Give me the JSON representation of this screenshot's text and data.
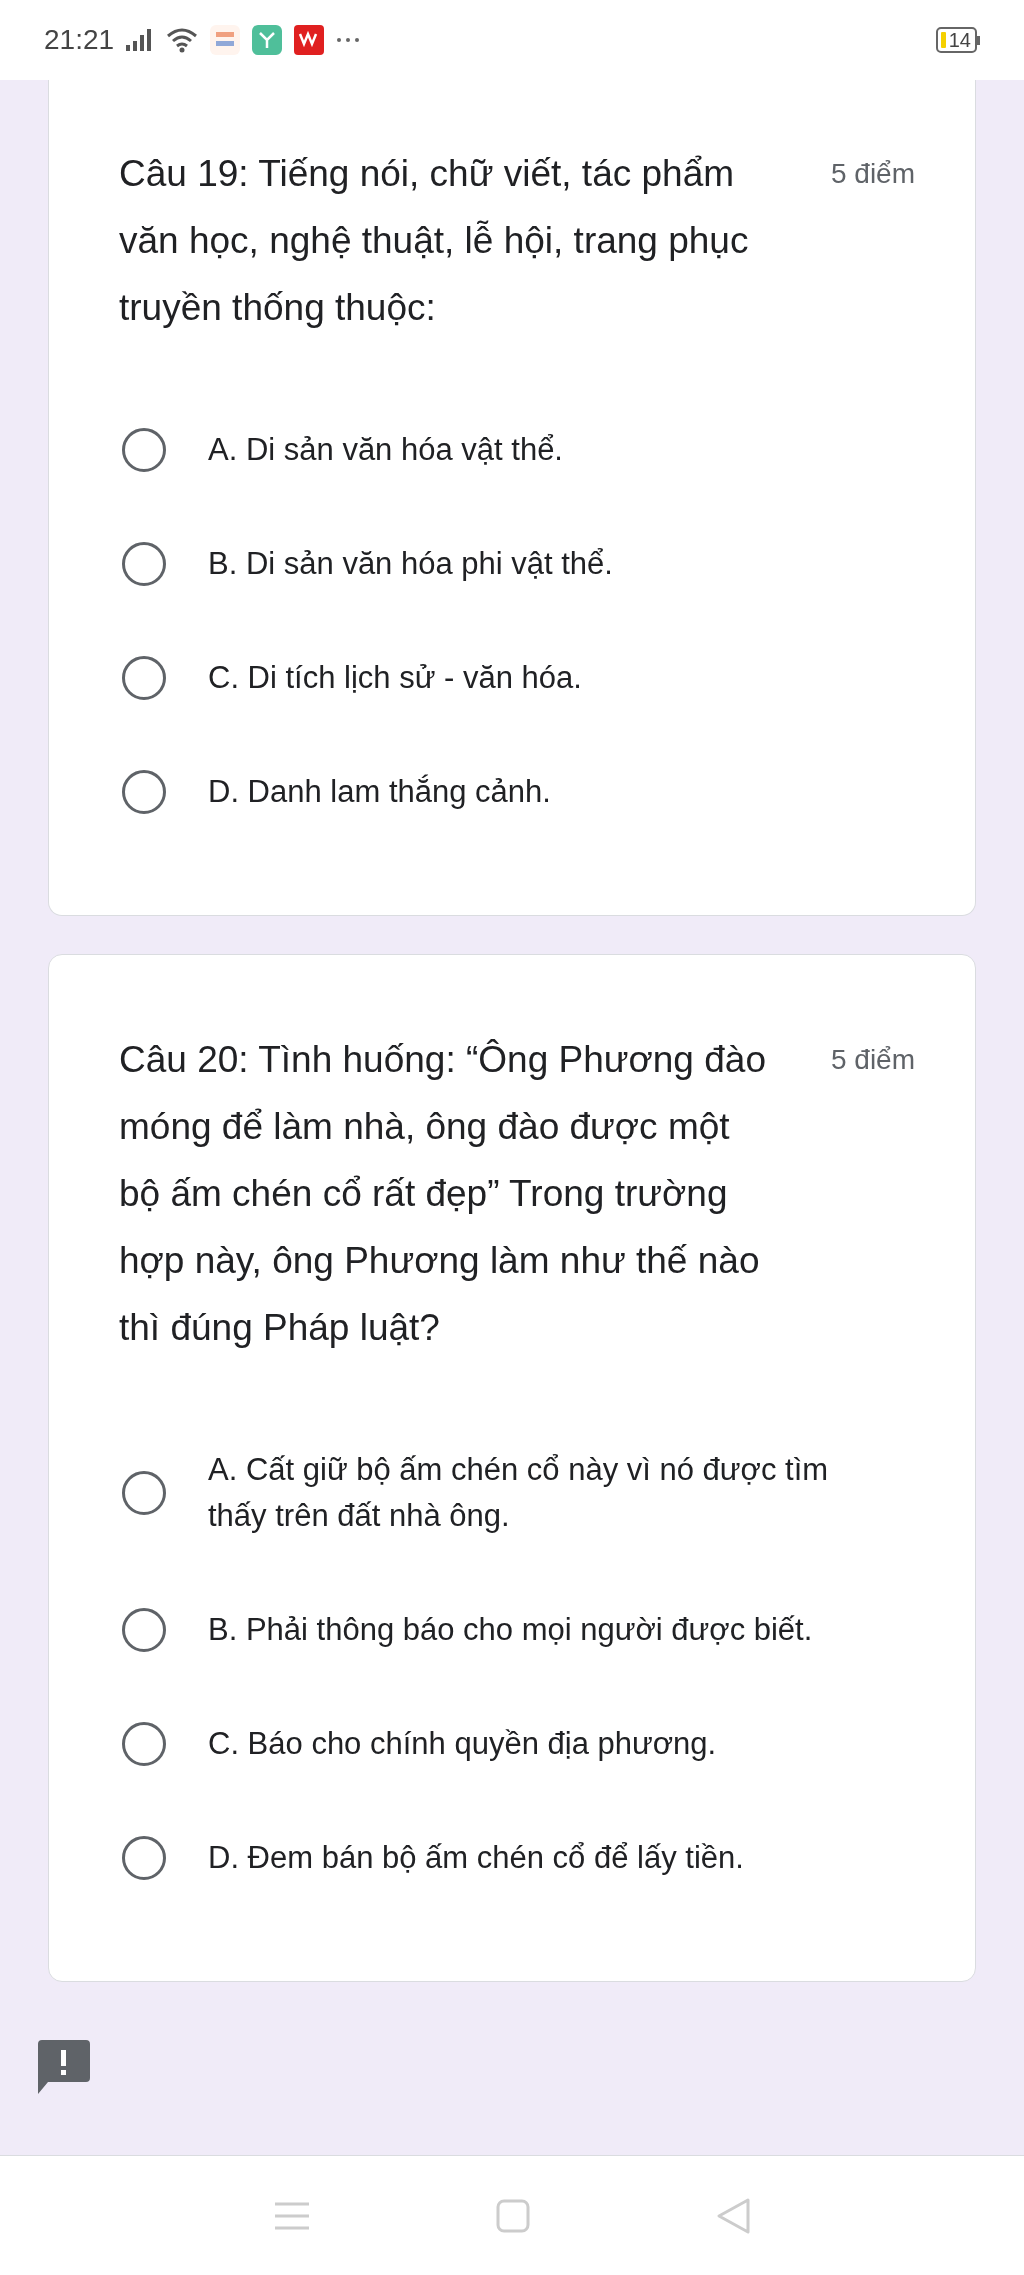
{
  "status_bar": {
    "time": "21:21",
    "battery": "14"
  },
  "questions": [
    {
      "title": "Câu 19: Tiếng nói, chữ viết, tác phẩm văn học, nghệ thuật, lễ hội, trang phục truyền thống thuộc:",
      "points": "5 điểm",
      "cut_top": true,
      "options": [
        {
          "label": "A. Di sản văn hóa vật thể.",
          "selected": false
        },
        {
          "label": "B. Di sản văn hóa phi vật thể.",
          "selected": false
        },
        {
          "label": "C. Di tích lịch sử - văn hóa.",
          "selected": false
        },
        {
          "label": "D. Danh lam thắng cảnh.",
          "selected": false
        }
      ]
    },
    {
      "title": "Câu 20: Tình huống: “Ông Phương đào móng để làm nhà, ông đào được một bộ ấm chén cổ rất đẹp” Trong trường hợp này, ông Phương làm như thế nào thì đúng Pháp luật?",
      "points": "5 điểm",
      "cut_top": false,
      "options": [
        {
          "label": "A. Cất giữ bộ ấm chén cổ này vì nó được tìm thấy trên đất nhà ông.",
          "selected": false
        },
        {
          "label": "B. Phải thông báo cho mọi người được biết.",
          "selected": false
        },
        {
          "label": "C. Báo cho chính quyền địa phương.",
          "selected": false
        },
        {
          "label": "D. Đem bán bộ ấm chén cổ để lấy tiền.",
          "selected": false
        }
      ]
    }
  ]
}
